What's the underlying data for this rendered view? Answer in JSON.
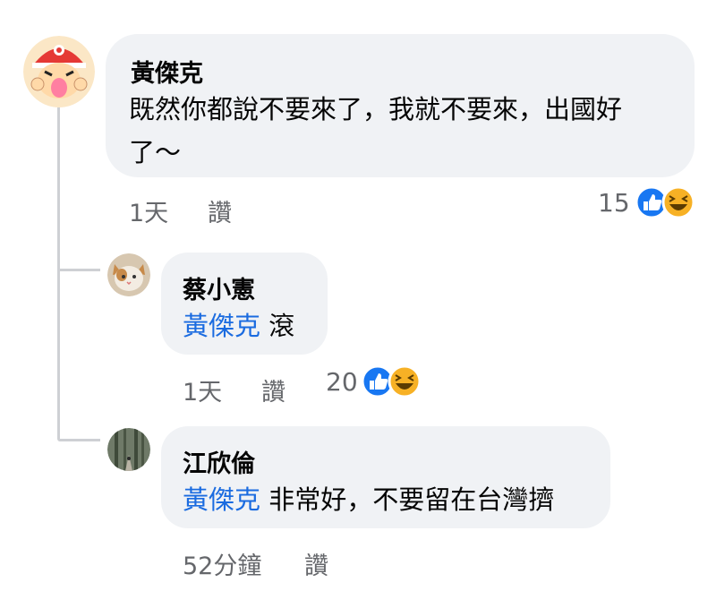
{
  "comment": {
    "author": "黃傑克",
    "text_line1": "既然你都說不要來了，我就不要來，出國好",
    "text_line2": "了～",
    "time": "1天",
    "like_label": "讚",
    "reaction_count": "15",
    "reactions": [
      "like-icon",
      "haha-icon"
    ]
  },
  "replies": [
    {
      "author": "蔡小憲",
      "mention": "黃傑克",
      "text": "滾",
      "time": "1天",
      "like_label": "讚",
      "reaction_count": "20",
      "reactions": [
        "like-icon",
        "haha-icon"
      ]
    },
    {
      "author": "江欣倫",
      "mention": "黃傑克",
      "text": "非常好，不要留在台灣擠",
      "time": "52分鐘",
      "like_label": "讚"
    }
  ],
  "colors": {
    "bubble": "#f0f2f5",
    "mention": "#1a6be0",
    "meta": "#65676b",
    "like_blue": "#1877f2",
    "haha_yellow": "#f7b125"
  }
}
